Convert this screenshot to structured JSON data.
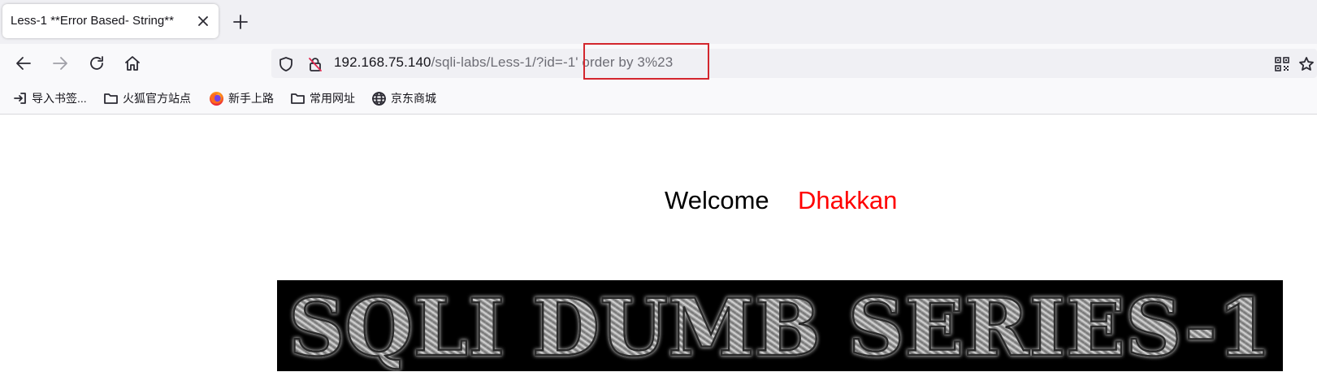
{
  "browser": {
    "tab": {
      "title": "Less-1 **Error Based- String**"
    },
    "url": {
      "host": "192.168.75.140",
      "path": "/sqli-labs/Less-1/?id=-1' order by 3%23"
    },
    "bookmarks": [
      {
        "label": "导入书签...",
        "icon": "import-icon"
      },
      {
        "label": "火狐官方站点",
        "icon": "folder-icon"
      },
      {
        "label": "新手上路",
        "icon": "firefox-icon"
      },
      {
        "label": "常用网址",
        "icon": "folder-icon"
      },
      {
        "label": "京东商城",
        "icon": "globe-icon"
      }
    ],
    "highlight_color": "#d3262d"
  },
  "page": {
    "welcome_text": "Welcome",
    "welcome_name": "Dhakkan",
    "welcome_name_color": "#ff0000",
    "banner_text": "SQLI DUMB SERIES-1"
  }
}
